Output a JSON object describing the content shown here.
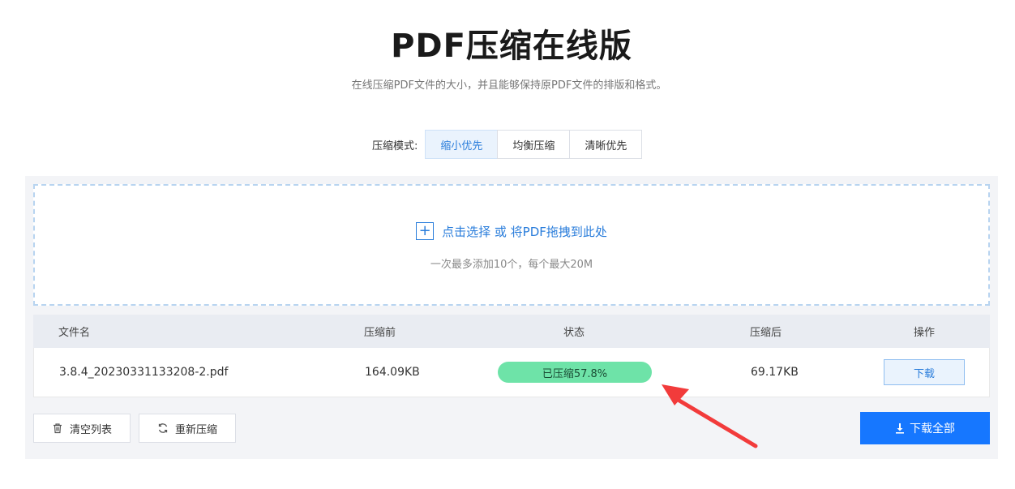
{
  "header": {
    "title": "PDF压缩在线版",
    "subtitle": "在线压缩PDF文件的大小，并且能够保持原PDF文件的排版和格式。"
  },
  "mode": {
    "label": "压缩模式:",
    "options": [
      "缩小优先",
      "均衡压缩",
      "清晰优先"
    ],
    "selected": "缩小优先"
  },
  "upload": {
    "text": "点击选择 或 将PDF拖拽到此处",
    "hint": "一次最多添加10个，每个最大20M"
  },
  "table": {
    "headers": [
      "文件名",
      "压缩前",
      "状态",
      "压缩后",
      "操作"
    ],
    "rows": [
      {
        "filename": "3.8.4_20230331133208-2.pdf",
        "size_before": "164.09KB",
        "status": "已压缩57.8%",
        "size_after": "69.17KB",
        "action": "下载"
      }
    ]
  },
  "footer": {
    "clear_label": "清空列表",
    "recompress_label": "重新压缩",
    "download_all_label": "下载全部"
  },
  "icons": {
    "upload": "plus-icon",
    "clear": "trash-icon",
    "recompress": "refresh-icon",
    "download_all": "download-icon",
    "annotation": "red-arrow"
  },
  "colors": {
    "accent": "#2a7ddb",
    "primary_button": "#1677ff",
    "progress": "#6ee3a8",
    "annotation_arrow": "#f23b3b"
  }
}
